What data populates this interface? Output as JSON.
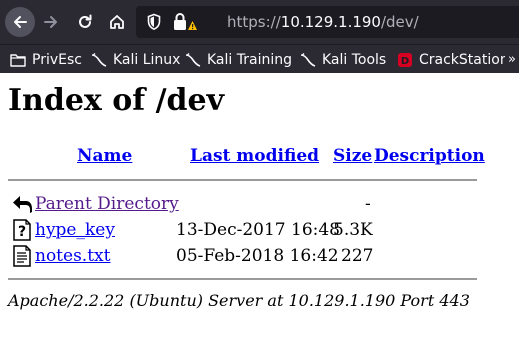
{
  "browser": {
    "url_protocol": "https://",
    "url_host": "10.129.1.190",
    "url_path": "/dev/",
    "nav_icons": [
      "back-arrow-icon",
      "forward-arrow-icon",
      "reload-icon",
      "home-icon",
      "shield-icon",
      "warning-lock-icon"
    ],
    "bookmarks": [
      {
        "label": "PrivEsc",
        "icon": "folder-icon"
      },
      {
        "label": "Kali Linux",
        "icon": "kali-dragon-icon"
      },
      {
        "label": "Kali Training",
        "icon": "kali-dragon-icon"
      },
      {
        "label": "Kali Tools",
        "icon": "kali-dragon-icon"
      },
      {
        "label": "CrackStation - ",
        "icon": "crackstation-icon"
      }
    ],
    "overflow_icon": "chevron-double-right-icon"
  },
  "page": {
    "title": "Index of /dev",
    "columns": {
      "name": "Name",
      "last_modified": "Last modified",
      "size": "Size",
      "description": "Description"
    },
    "rows": [
      {
        "name": "Parent Directory",
        "last_modified": "",
        "size": "-",
        "description": "",
        "icon": "back-folder-icon"
      },
      {
        "name": "hype_key",
        "last_modified": "13-Dec-2017 16:48",
        "size": "5.3K",
        "description": "",
        "icon": "unknown-file-icon"
      },
      {
        "name": "notes.txt",
        "last_modified": "05-Feb-2018 16:42",
        "size": "227",
        "description": "",
        "icon": "text-file-icon"
      }
    ],
    "address": "Apache/2.2.22 (Ubuntu) Server at 10.129.1.190 Port 443"
  },
  "colors": {
    "chrome_bg": "#2b2a33",
    "urlbar_bg": "#1c1b22",
    "link": "#0000ee",
    "visited_link": "#551a8b",
    "warning": "#ffbf00",
    "crackstation_red": "#d70022"
  }
}
